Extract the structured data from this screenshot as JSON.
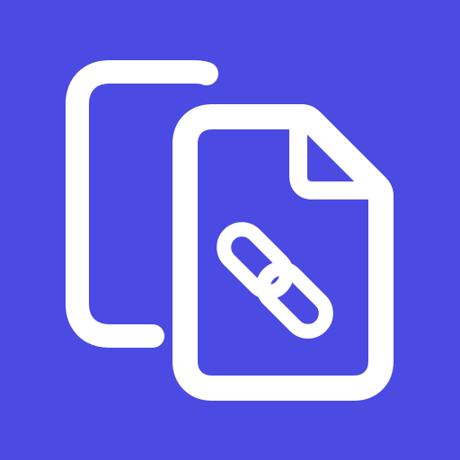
{
  "icon": {
    "name": "copy-link-file-icon",
    "colors": {
      "background": "#4B4AE2",
      "foreground": "#FFFFFF"
    }
  }
}
